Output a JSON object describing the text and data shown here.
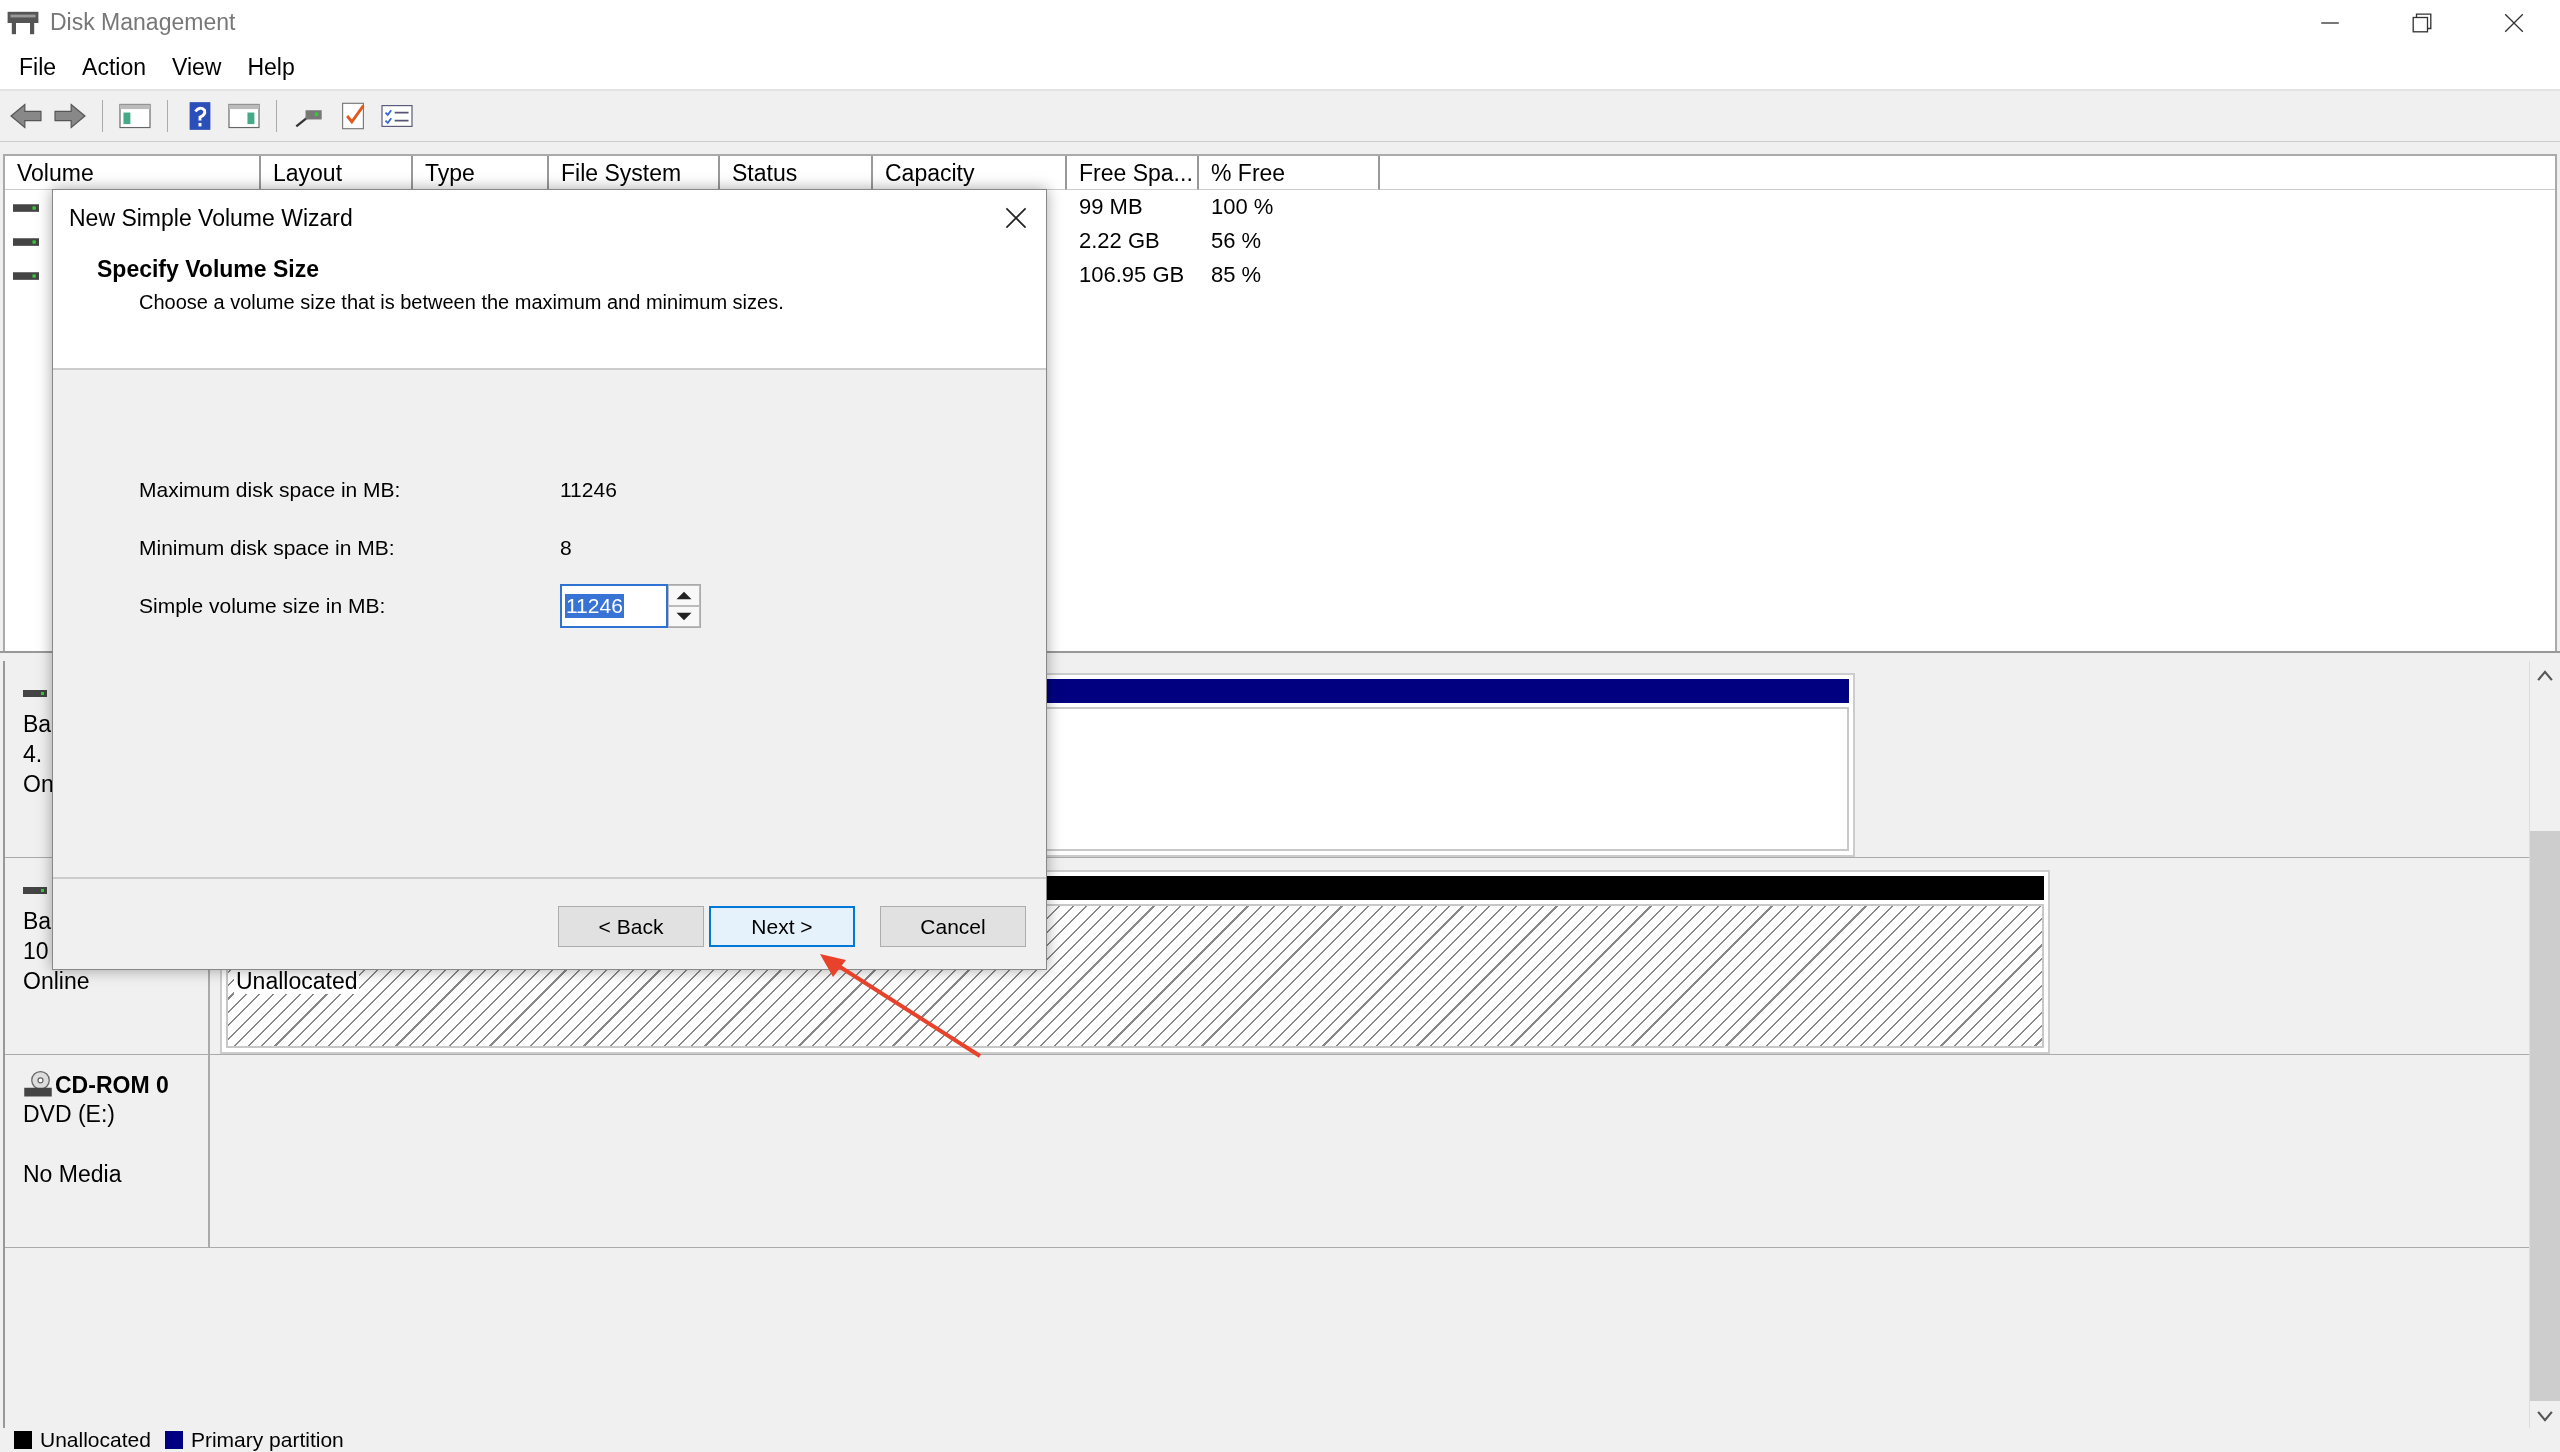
{
  "window": {
    "title": "Disk Management"
  },
  "menu": [
    "File",
    "Action",
    "View",
    "Help"
  ],
  "volume_table": {
    "columns": [
      "Volume",
      "Layout",
      "Type",
      "File System",
      "Status",
      "Capacity",
      "Free Spa...",
      "% Free"
    ],
    "rows": [
      {
        "free_space": "99 MB",
        "percent_free": "100 %"
      },
      {
        "free_space": "2.22 GB",
        "percent_free": "56 %"
      },
      {
        "free_space": "106.95 GB",
        "percent_free": "85 %"
      }
    ]
  },
  "disks": [
    {
      "kind": "disk",
      "lines": [
        "Ba",
        "4.",
        "On"
      ],
      "partitions": [
        {
          "kind": "primary"
        }
      ]
    },
    {
      "kind": "disk",
      "lines": [
        "Ba",
        "10",
        "Online"
      ],
      "partitions": [
        {
          "kind": "unallocated",
          "label": "Unallocated"
        }
      ]
    },
    {
      "kind": "cdrom",
      "name": "CD-ROM 0",
      "lines": [
        "DVD (E:)"
      ],
      "status": "No Media"
    }
  ],
  "legend": [
    {
      "label": "Unallocated",
      "color": "#000000"
    },
    {
      "label": "Primary partition",
      "color": "#000080"
    }
  ],
  "dialog": {
    "title": "New Simple Volume Wizard",
    "heading": "Specify Volume Size",
    "subtitle": "Choose a volume size that is between the maximum and minimum sizes.",
    "fields": [
      {
        "kind": "text",
        "label": "Maximum disk space in MB:",
        "value": "11246"
      },
      {
        "kind": "text",
        "label": "Minimum disk space in MB:",
        "value": "8"
      },
      {
        "kind": "spin",
        "label": "Simple volume size in MB:",
        "value": "11246",
        "highlighted": true
      }
    ],
    "buttons": [
      {
        "label": "< Back",
        "default": false
      },
      {
        "label": "Next >",
        "default": true
      },
      {
        "label": "Cancel",
        "default": false
      }
    ]
  }
}
